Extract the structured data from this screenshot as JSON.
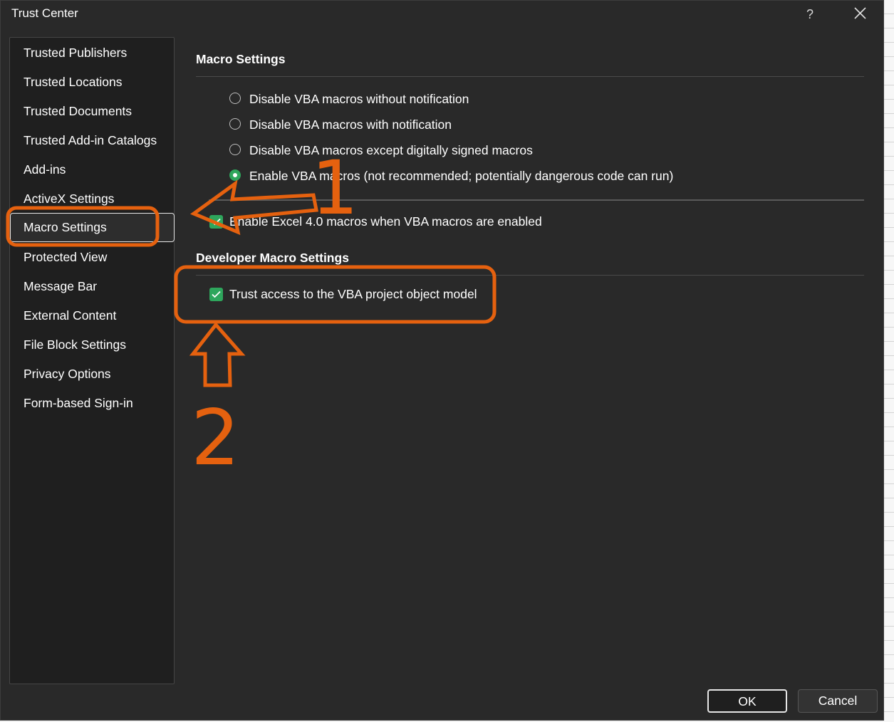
{
  "window": {
    "title": "Trust Center",
    "help_label": "?"
  },
  "sidebar": {
    "items": [
      {
        "label": "Trusted Publishers"
      },
      {
        "label": "Trusted Locations"
      },
      {
        "label": "Trusted Documents"
      },
      {
        "label": "Trusted Add-in Catalogs"
      },
      {
        "label": "Add-ins"
      },
      {
        "label": "ActiveX Settings"
      },
      {
        "label": "Macro Settings",
        "selected": true
      },
      {
        "label": "Protected View"
      },
      {
        "label": "Message Bar"
      },
      {
        "label": "External Content"
      },
      {
        "label": "File Block Settings"
      },
      {
        "label": "Privacy Options"
      },
      {
        "label": "Form-based Sign-in"
      }
    ]
  },
  "macro_settings": {
    "header": "Macro Settings",
    "options": [
      {
        "label": "Disable VBA macros without notification",
        "selected": false
      },
      {
        "label": "Disable VBA macros with notification",
        "selected": false
      },
      {
        "label": "Disable VBA macros except digitally signed macros",
        "selected": false
      },
      {
        "label": "Enable VBA macros (not recommended; potentially dangerous code can run)",
        "selected": true
      }
    ],
    "excel4": {
      "label": "Enable Excel 4.0 macros when VBA macros are enabled",
      "checked": true
    }
  },
  "developer_settings": {
    "header": "Developer Macro Settings",
    "trust_vba": {
      "label": "Trust access to the VBA project object model",
      "checked": true
    }
  },
  "buttons": {
    "ok": "OK",
    "cancel": "Cancel"
  },
  "annotations": {
    "step1": "1",
    "step2": "2",
    "color": "#e5610f"
  },
  "colors": {
    "accent_green": "#2ea65c",
    "dialog_bg": "#292929",
    "nav_bg": "#1f1f1f"
  },
  "icons": {
    "close": "close-icon",
    "help": "help-icon",
    "check": "checkmark-icon"
  }
}
